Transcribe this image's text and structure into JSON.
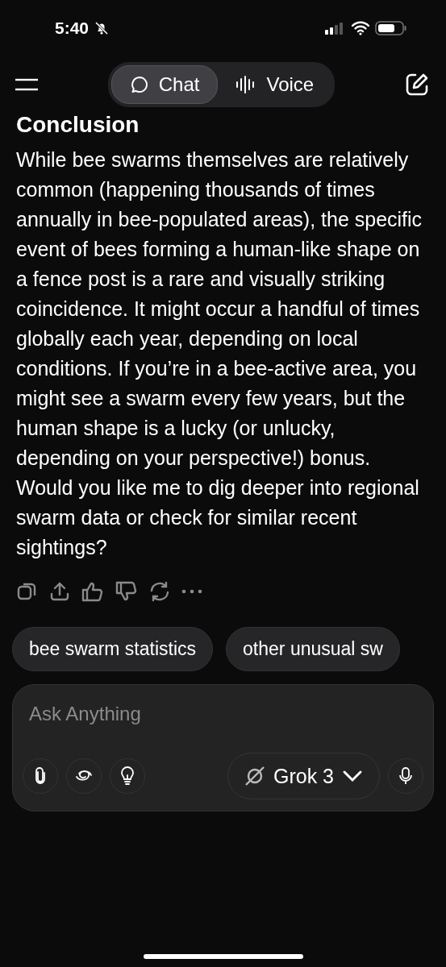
{
  "status_bar": {
    "time": "5:40",
    "silent": true
  },
  "tabs": [
    {
      "label": "Chat",
      "kind": "chat",
      "selected": true
    },
    {
      "label": "Voice",
      "kind": "voice",
      "selected": false
    }
  ],
  "message": {
    "heading": "Conclusion",
    "text": "While bee swarms themselves are relatively common (happening thousands of times annually in bee-populated areas), the specific event of bees forming a human-like shape on a fence post is a rare and visually striking coincidence. It might occur a handful of times globally each year, depending on local conditions. If you’re in a bee-active area, you might see a swarm every few years, but the human shape is a lucky (or unlucky, depending on your perspective!) bonus. Would you like me to dig deeper into regional swarm data or check for similar recent sightings?",
    "actions": [
      {
        "kind": "copy"
      },
      {
        "kind": "share"
      },
      {
        "kind": "like"
      },
      {
        "kind": "dislike"
      },
      {
        "kind": "regenerate"
      },
      {
        "kind": "more"
      }
    ]
  },
  "suggestions": [
    "bee swarm statistics",
    "other unusual sw"
  ],
  "composer": {
    "placeholder": "Ask Anything",
    "model": "Grok 3"
  }
}
